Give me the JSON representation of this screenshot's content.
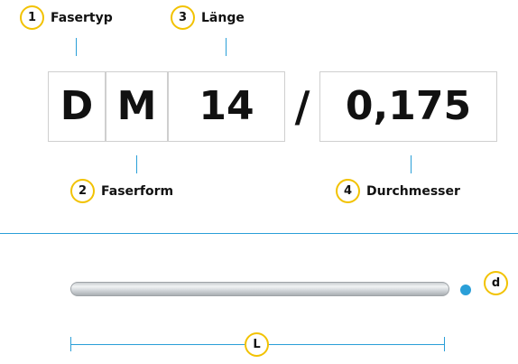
{
  "callouts": {
    "fasertyp": {
      "number": "1",
      "label": "Fasertyp"
    },
    "laenge": {
      "number": "3",
      "label": "Länge"
    },
    "faserform": {
      "number": "2",
      "label": "Faserform"
    },
    "durchmesser": {
      "number": "4",
      "label": "Durchmesser"
    }
  },
  "code": {
    "fasertyp": "D",
    "faserform": "M",
    "laenge": "14",
    "separator": "/",
    "durchmesser": "0,175"
  },
  "dimensions": {
    "diameter_label": "d",
    "length_label": "L"
  },
  "colors": {
    "accent_blue": "#2a9fd8",
    "badge_yellow": "#f2c200",
    "box_border": "#cfcfcf"
  }
}
